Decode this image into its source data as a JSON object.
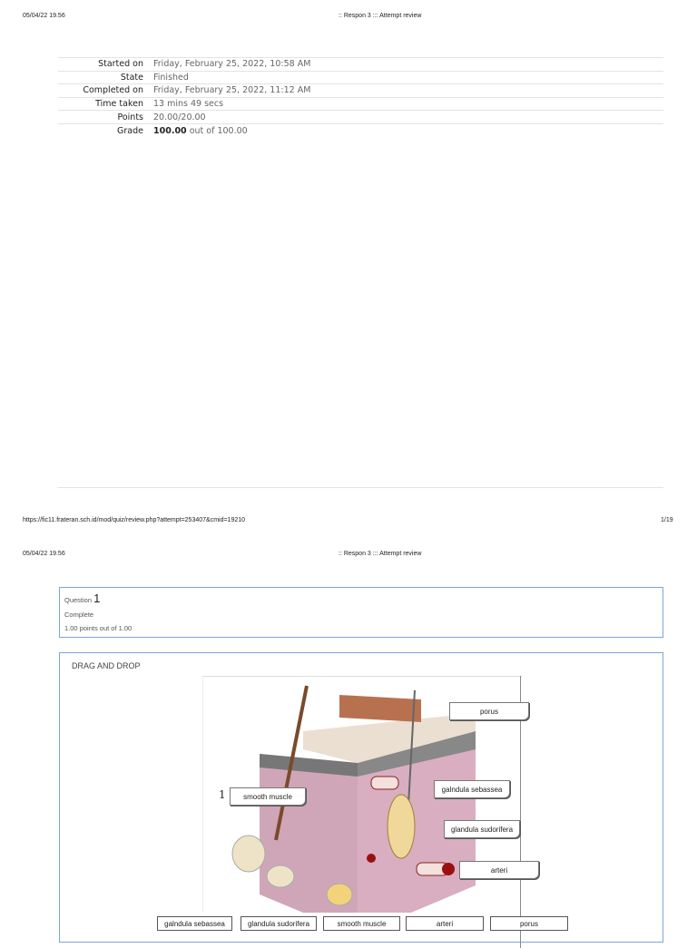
{
  "page1": {
    "timestamp": "05/04/22 19.56",
    "title": ":: Respon 3 ::: Attempt review",
    "url": "https://fic11.frateran.sch.id/mod/quiz/review.php?attempt=253407&cmid=19210",
    "page": "1/19"
  },
  "summary": [
    {
      "label": "Started on",
      "value": "Friday, February 25, 2022, 10:58 AM"
    },
    {
      "label": "State",
      "value": "Finished"
    },
    {
      "label": "Completed on",
      "value": "Friday, February 25, 2022, 11:12 AM"
    },
    {
      "label": "Time taken",
      "value": "13 mins 49 secs"
    },
    {
      "label": "Points",
      "value": "20.00/20.00"
    },
    {
      "label": "Grade",
      "value_bold": "100.00",
      "value": " out of 100.00"
    }
  ],
  "page2": {
    "timestamp": "05/04/22 19.56",
    "title": ":: Respon 3 ::: Attempt review"
  },
  "question": {
    "label": "Question",
    "number": "1",
    "status": "Complete",
    "points": "1.00 points out of 1.00",
    "text": "DRAG AND DROP",
    "marker": "1",
    "drops": [
      "porus",
      "galndula sebassea",
      "smooth muscle",
      "glandula sudorifera",
      "arteri"
    ],
    "choices": [
      "galndula sebassea",
      "glandula sudorifera",
      "smooth muscle",
      "arteri",
      "porus"
    ]
  }
}
